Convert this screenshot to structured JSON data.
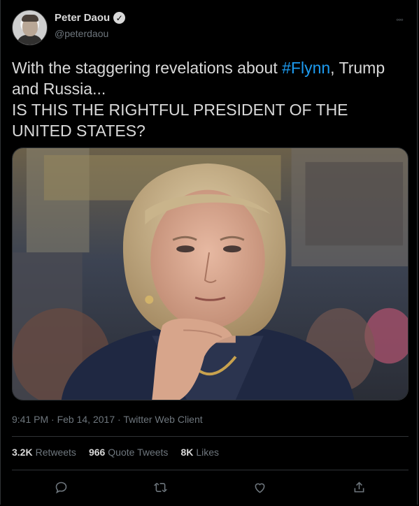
{
  "author": {
    "name": "Peter Daou",
    "handle": "@peterdaou",
    "verified_icon": "verified-badge-icon"
  },
  "tweet": {
    "text_before_hashtag": "With the staggering revelations about ",
    "hashtag": "#Flynn",
    "text_after_hashtag": ", Trump and Russia...",
    "line2": "IS THIS THE RIGHTFUL PRESIDENT OF THE UNITED STATES?"
  },
  "meta": {
    "time": "9:41 PM",
    "sep1": " · ",
    "date": "Feb 14, 2017",
    "sep2": " · ",
    "client": "Twitter Web Client"
  },
  "stats": {
    "retweets_count": "3.2K",
    "retweets_label": "Retweets",
    "quotes_count": "966",
    "quotes_label": "Quote Tweets",
    "likes_count": "8K",
    "likes_label": "Likes"
  },
  "actions": [
    "reply-icon",
    "retweet-icon",
    "like-icon",
    "share-icon"
  ],
  "colors": {
    "background": "#000000",
    "text": "#d9d9d9",
    "muted": "#6e767d",
    "link": "#1d9bf0",
    "divider": "#2f3336"
  }
}
